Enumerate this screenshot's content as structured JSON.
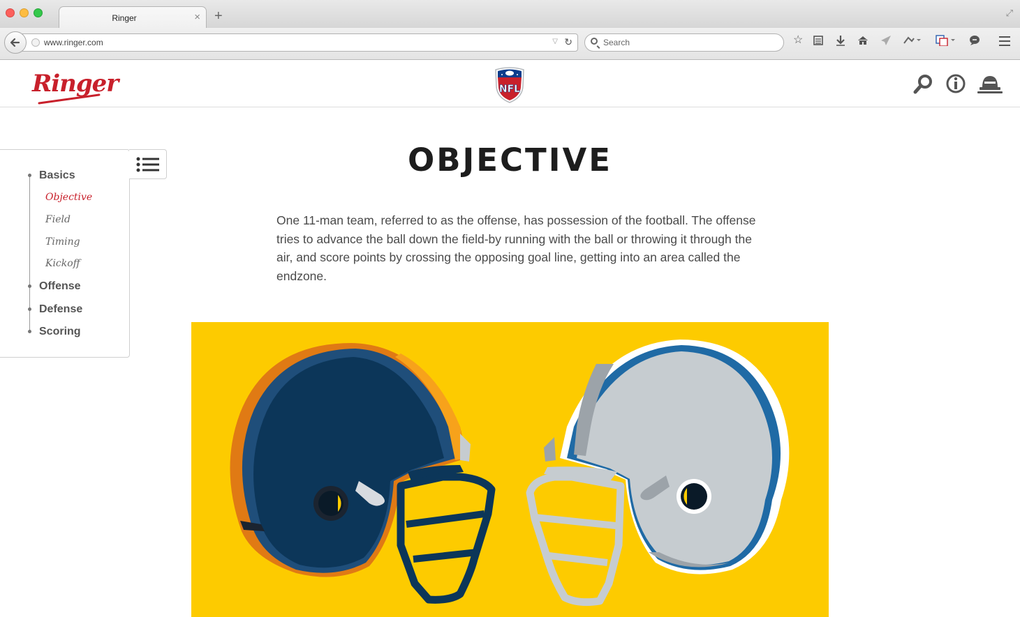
{
  "browser": {
    "tab_title": "Ringer",
    "tab_close": "×",
    "new_tab": "+",
    "url": "www.ringer.com",
    "search_placeholder": "Search"
  },
  "toolbar_icons": [
    "star-icon",
    "reading-list-icon",
    "download-icon",
    "home-icon",
    "send-icon",
    "extension-icon",
    "translate-icon",
    "chat-icon",
    "menu-icon"
  ],
  "site": {
    "brand": "Ringer",
    "league_logo": "NFL",
    "header_icons": [
      "search-icon",
      "info-icon",
      "profile-icon"
    ],
    "colors": {
      "brand_red": "#c8202b",
      "hero_yellow": "#fdcb00",
      "navy": "#0c3659",
      "silver": "#c6ccd0"
    }
  },
  "toc": {
    "items": [
      {
        "label": "Basics",
        "children": [
          "Objective",
          "Field",
          "Timing",
          "Kickoff"
        ]
      },
      {
        "label": "Offense"
      },
      {
        "label": "Defense"
      },
      {
        "label": "Scoring"
      }
    ],
    "active": "Objective"
  },
  "article": {
    "title": "OBJECTIVE",
    "paragraph": "One 11-man team, referred to as the offense, has possession of the football. The offense tries to advance the ball down the field-by running with the ball or throwing it through the air, and score points by crossing the opposing goal line, getting into an area called the endzone."
  }
}
